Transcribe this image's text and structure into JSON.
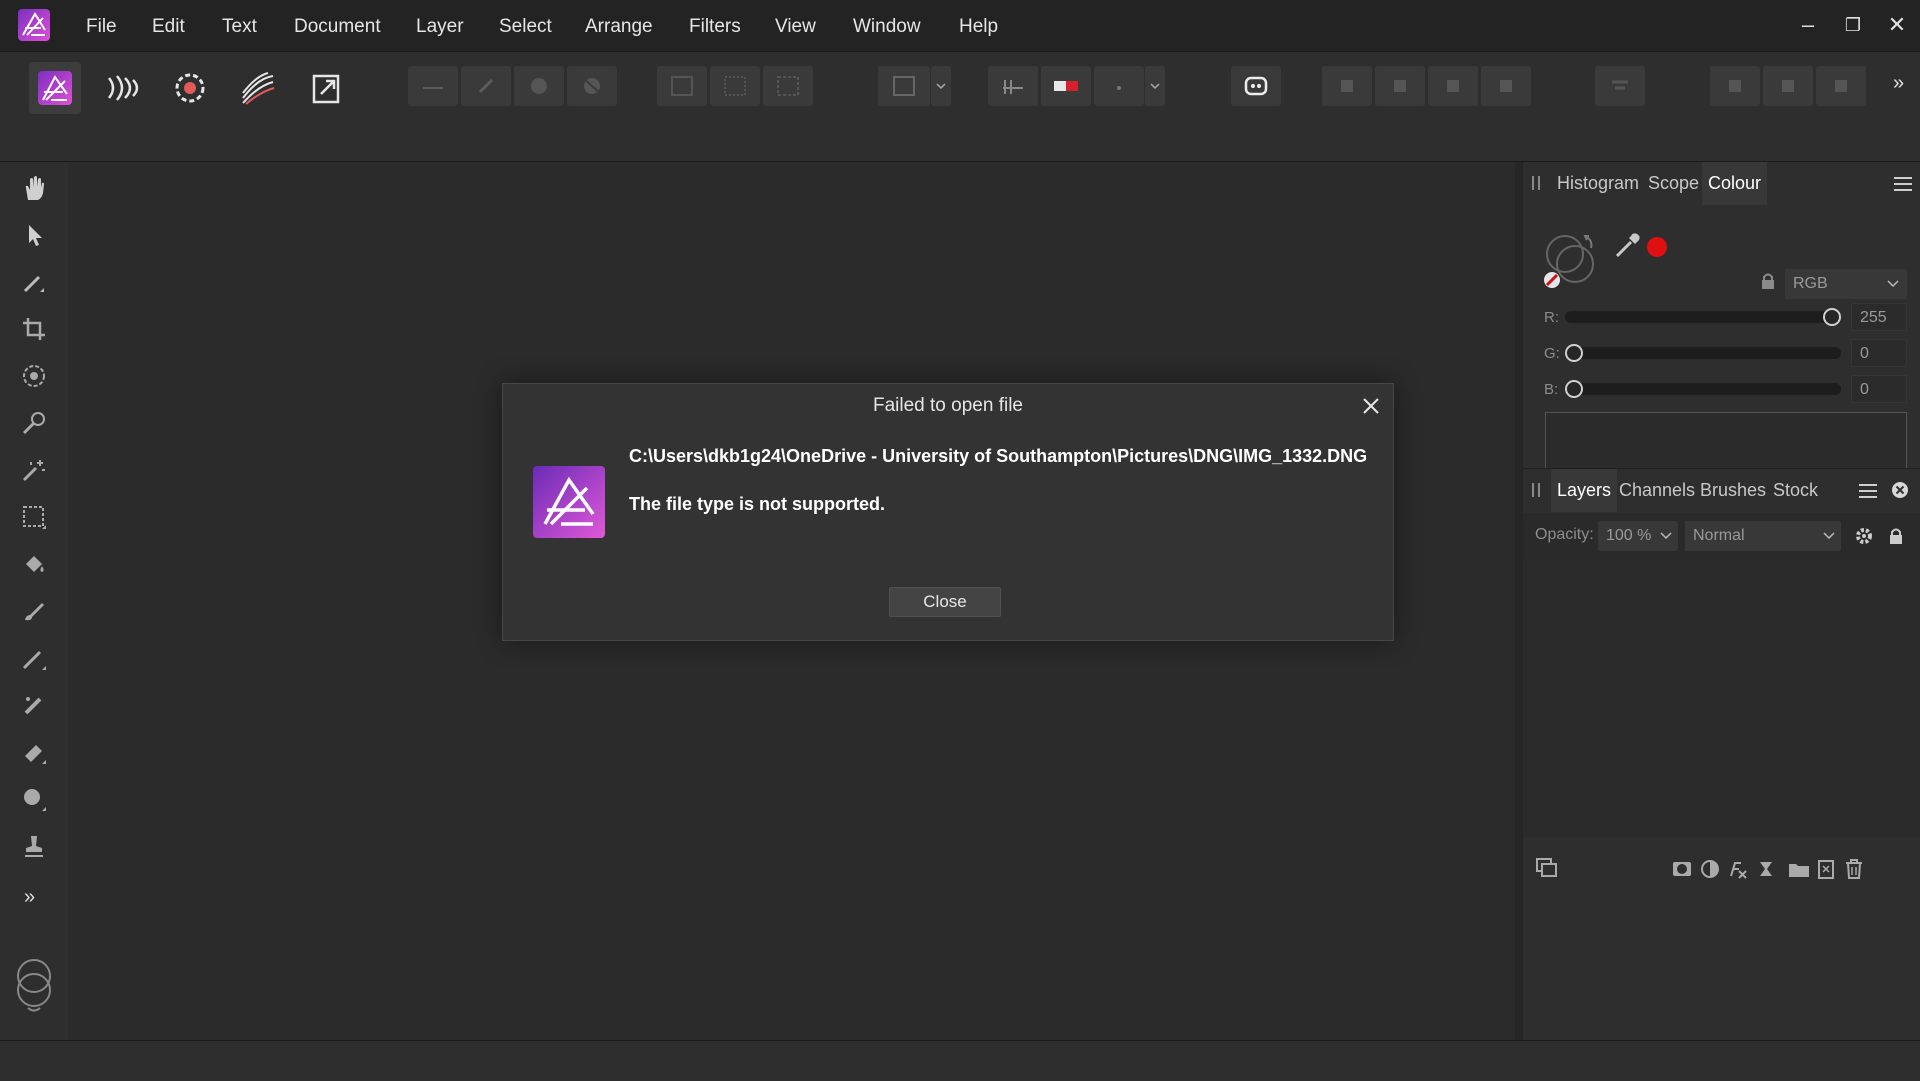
{
  "app": {
    "name": "Affinity Photo 2",
    "logo_icon": "affinity-photo-logo",
    "accent_color": "#c63ed6"
  },
  "menu": {
    "items": [
      "File",
      "Edit",
      "Text",
      "Document",
      "Layer",
      "Select",
      "Arrange",
      "Filters",
      "View",
      "Window",
      "Help"
    ]
  },
  "window_controls": {
    "minimize": "–",
    "maximize": "❐",
    "close": "✕"
  },
  "toolbar": {
    "personas": [
      "photo-persona-icon",
      "liquify-persona-icon",
      "develop-persona-icon",
      "tone-mapping-persona-icon",
      "export-persona-icon"
    ],
    "overflow": "»"
  },
  "colour_panel": {
    "tabs": [
      "Histogram",
      "Scope",
      "Colour"
    ],
    "active_tab": "Colour",
    "model": "RGB",
    "current_color": "#e01010",
    "sliders": [
      {
        "label": "R:",
        "value": "255",
        "fraction": 1.0
      },
      {
        "label": "G:",
        "value": "0",
        "fraction": 0.0
      },
      {
        "label": "B:",
        "value": "0",
        "fraction": 0.0
      }
    ]
  },
  "layers_panel": {
    "tabs": [
      "Layers",
      "Channels",
      "Brushes",
      "Stock"
    ],
    "active_tab": "Layers",
    "opacity_label": "Opacity:",
    "opacity_value": "100 %",
    "blend_mode": "Normal"
  },
  "dialog": {
    "title": "Failed to open file",
    "path": "C:\\Users\\dkb1g24\\OneDrive - University of Southampton\\Pictures\\DNG\\IMG_1332.DNG",
    "message": "The file type is not supported.",
    "close_label": "Close"
  },
  "left_tools_expand": "»"
}
